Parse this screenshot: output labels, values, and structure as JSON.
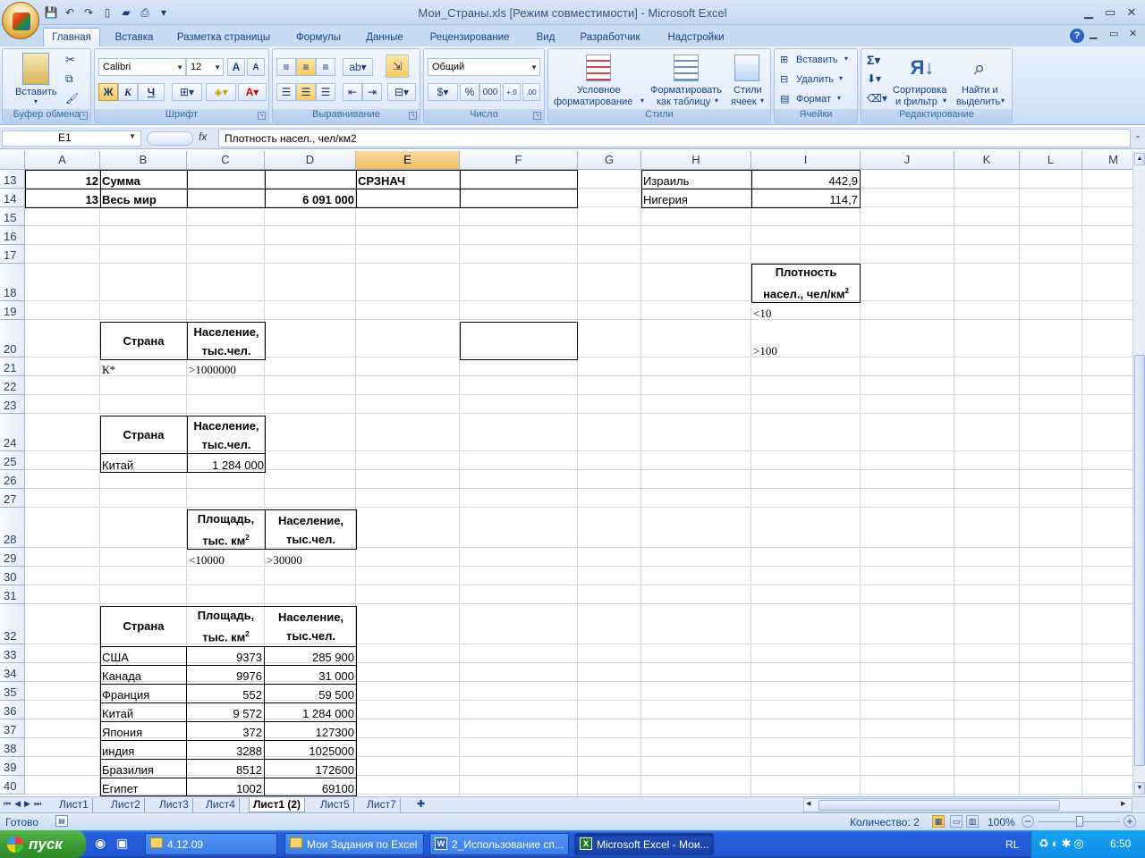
{
  "window": {
    "title": "Мои_Страны.xls  [Режим совместимости] - Microsoft Excel"
  },
  "ribbon_tabs": [
    "Главная",
    "Вставка",
    "Разметка страницы",
    "Формулы",
    "Данные",
    "Рецензирование",
    "Вид",
    "Разработчик",
    "Надстройки"
  ],
  "ribbon": {
    "clipboard": {
      "paste": "Вставить",
      "label": "Буфер обмена"
    },
    "font": {
      "name": "Calibri",
      "size": "12",
      "bold": "Ж",
      "italic": "К",
      "underline": "Ч",
      "label": "Шрифт"
    },
    "alignment": {
      "label": "Выравнивание"
    },
    "number": {
      "format": "Общий",
      "percent": "%",
      "thousands": "000",
      "label": "Число"
    },
    "styles": {
      "conditional_1": "Условное",
      "conditional_2": "форматирование",
      "table_1": "Форматировать",
      "table_2": "как таблицу",
      "cell_1": "Стили",
      "cell_2": "ячеек",
      "label": "Стили"
    },
    "cells": {
      "insert": "Вставить",
      "delete": "Удалить",
      "format": "Формат",
      "label": "Ячейки"
    },
    "editing": {
      "sort_1": "Сортировка",
      "sort_2": "и фильтр",
      "find_1": "Найти и",
      "find_2": "выделить",
      "label": "Редактирование"
    }
  },
  "formula_bar": {
    "name_box": "E1",
    "fx": "fx",
    "content": "Плотность насел., чел/км2"
  },
  "columns": [
    "A",
    "B",
    "C",
    "D",
    "E",
    "F",
    "G",
    "H",
    "I",
    "J",
    "K",
    "L",
    "M"
  ],
  "rows": [
    "13",
    "14",
    "15",
    "16",
    "17",
    "18",
    "19",
    "20",
    "21",
    "22",
    "23",
    "24",
    "25",
    "26",
    "27",
    "28",
    "29",
    "30",
    "31",
    "32",
    "33",
    "34",
    "35",
    "36",
    "37",
    "38",
    "39",
    "40"
  ],
  "cells": {
    "A13": "12",
    "B13": "Сумма",
    "E13": "СРЗНАЧ",
    "H13": "Израиль",
    "I13": "442,9",
    "A14": "13",
    "B14": "Весь мир",
    "D14": "6 091 000",
    "H14": "Нигерия",
    "I14": "114,7",
    "I18_l1": "Плотность",
    "I18_l2": "насел., чел/км",
    "I18_sup": "2",
    "I19": "<10",
    "I20": ">100",
    "B20": "Страна",
    "C20_l1": "Население,",
    "C20_l2": "тыс.чел.",
    "B21": "К*",
    "C21": ">1000000",
    "B24": "Страна",
    "C24_l1": "Население,",
    "C24_l2": "тыс.чел.",
    "B25": "Китай",
    "C25": "1 284 000",
    "C28_l1": "Площадь,",
    "C28_l2": "тыс. км",
    "C28_sup": "2",
    "D28_l1": "Население,",
    "D28_l2": "тыс.чел.",
    "C29": "<10000",
    "D29": ">30000",
    "B32": "Страна",
    "C32_l1": "Площадь,",
    "C32_l2": "тыс. км",
    "C32_sup": "2",
    "D32_l1": "Население,",
    "D32_l2": "тыс.чел."
  },
  "country_table": [
    {
      "country": "США",
      "area": "9373",
      "population": "285 900"
    },
    {
      "country": "Канада",
      "area": "9976",
      "population": "31 000"
    },
    {
      "country": "Франция",
      "area": "552",
      "population": "59 500"
    },
    {
      "country": "Китай",
      "area": "9 572",
      "population": "1 284 000"
    },
    {
      "country": "Япония",
      "area": "372",
      "population": "127300"
    },
    {
      "country": "индия",
      "area": "3288",
      "population": "1025000"
    },
    {
      "country": "Бразилия",
      "area": "8512",
      "population": "172600"
    },
    {
      "country": "Египет",
      "area": "1002",
      "population": "69100"
    }
  ],
  "sheet_tabs": [
    "Лист1",
    "Лист2",
    "Лист3",
    "Лист4",
    "Лист1 (2)",
    "Лист5",
    "Лист7"
  ],
  "status": {
    "ready": "Готово",
    "count": "Количество: 2",
    "zoom": "100%"
  },
  "taskbar": {
    "start": "пуск",
    "items": [
      "4.12.09",
      "Мои Задания по Excel",
      "2_Использование сп...",
      "Microsoft Excel - Мои..."
    ],
    "lang": "RL",
    "clock": "6:50"
  }
}
